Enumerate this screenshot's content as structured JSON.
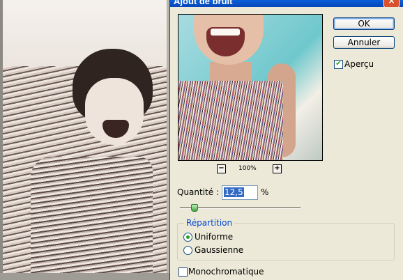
{
  "window": {
    "title": "Ajout de bruit",
    "close_glyph": "×"
  },
  "preview": {
    "zoom_out_glyph": "−",
    "zoom_in_glyph": "+",
    "zoom_level": "100%"
  },
  "buttons": {
    "ok_label": "OK",
    "cancel_label": "Annuler"
  },
  "apercu": {
    "label": "Aperçu",
    "checked": true,
    "check_glyph": "✔"
  },
  "quantity": {
    "label": "Quantité :",
    "value": "12,5",
    "unit": "%",
    "slider_fraction": 0.125
  },
  "distribution": {
    "legend": "Répartition",
    "options": [
      "Uniforme",
      "Gaussienne"
    ],
    "selected": "Uniforme"
  },
  "monochromatic": {
    "label": "Monochromatique",
    "checked": false
  },
  "colors": {
    "titlebar": "#0a5fd8",
    "accent_green": "#21a121",
    "legend_blue": "#0046d5",
    "selection_blue": "#316ac5"
  }
}
